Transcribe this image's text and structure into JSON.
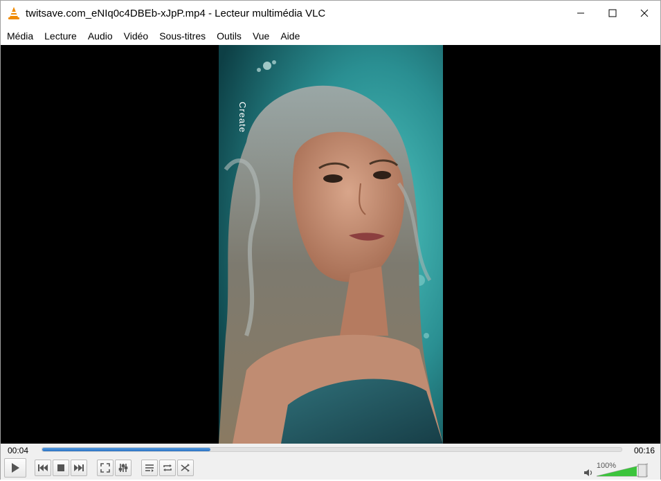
{
  "window": {
    "title": "twitsave.com_eNIq0c4DBEb-xJpP.mp4 - Lecteur multimédia VLC",
    "icon": "vlc-cone-icon",
    "controls": [
      "minimize-icon",
      "maximize-icon",
      "close-icon"
    ]
  },
  "menu": {
    "items": [
      "Média",
      "Lecture",
      "Audio",
      "Vidéo",
      "Sous-titres",
      "Outils",
      "Vue",
      "Aide"
    ]
  },
  "video": {
    "overlay_text": "Create"
  },
  "playback": {
    "elapsed": "00:04",
    "total": "00:16",
    "progress": 0.29
  },
  "volume": {
    "label": "100%",
    "level": 1.0
  },
  "colors": {
    "accent": "#2a72c4",
    "volume_green": "#3cc43c",
    "vlc_orange": "#f08a00"
  }
}
